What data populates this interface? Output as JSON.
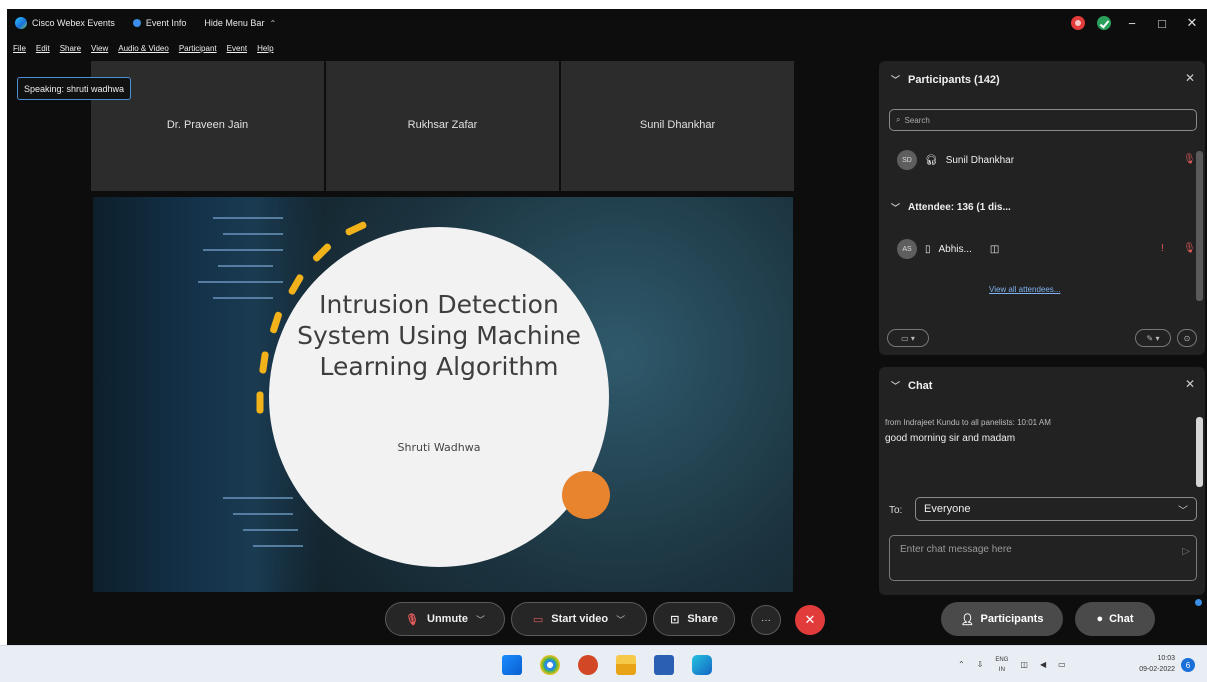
{
  "titlebar": {
    "app_name": "Cisco Webex Events",
    "event_info": "Event Info",
    "hide_menu": "Hide Menu Bar",
    "caret": "⌃",
    "minimize": "−",
    "maximize": "□",
    "close": "✕"
  },
  "menubar": {
    "items": [
      "File",
      "Edit",
      "Share",
      "View",
      "Audio & Video",
      "Participant",
      "Event",
      "Help"
    ]
  },
  "speaking": {
    "label": "Speaking: shruti wadhwa"
  },
  "thumbnails": [
    {
      "name": "Dr. Praveen Jain"
    },
    {
      "name": "Rukhsar Zafar"
    },
    {
      "name": "Sunil Dhankhar"
    }
  ],
  "slide": {
    "title": "Intrusion Detection System Using Machine Learning Algorithm",
    "subtitle": "Shruti Wadhwa"
  },
  "participants_panel": {
    "title": "Participants (142)",
    "close": "✕",
    "search_placeholder": "Search",
    "host_initials": "SD",
    "host_name": "Sunil Dhankhar",
    "attendee_header": "Attendee: 136 (1 dis...",
    "attendee_initials": "AS",
    "attendee_name": "Abhis...",
    "view_all": "View all attendees..."
  },
  "chat_panel": {
    "title": "Chat",
    "close": "✕",
    "message_from": "from Indrajeet Kundu  to all panelists:    10:01 AM",
    "message_text": "good morning sir and madam",
    "to_label": "To:",
    "to_value": "Everyone",
    "input_placeholder": "Enter chat message here"
  },
  "controls": {
    "unmute": "Unmute",
    "start_video": "Start video",
    "share": "Share",
    "more": "···",
    "end": "✕",
    "participants": "Participants",
    "chat": "Chat"
  },
  "taskbar": {
    "language_top": "ENG",
    "language_bottom": "IN",
    "time": "10:03",
    "date": "09-02-2022",
    "notification_count": "6"
  },
  "colors": {
    "accent_blue": "#4a90d9",
    "end_red": "#e23b3b",
    "slide_orange": "#e8832e",
    "slide_dash_yellow": "#f2b21a"
  }
}
